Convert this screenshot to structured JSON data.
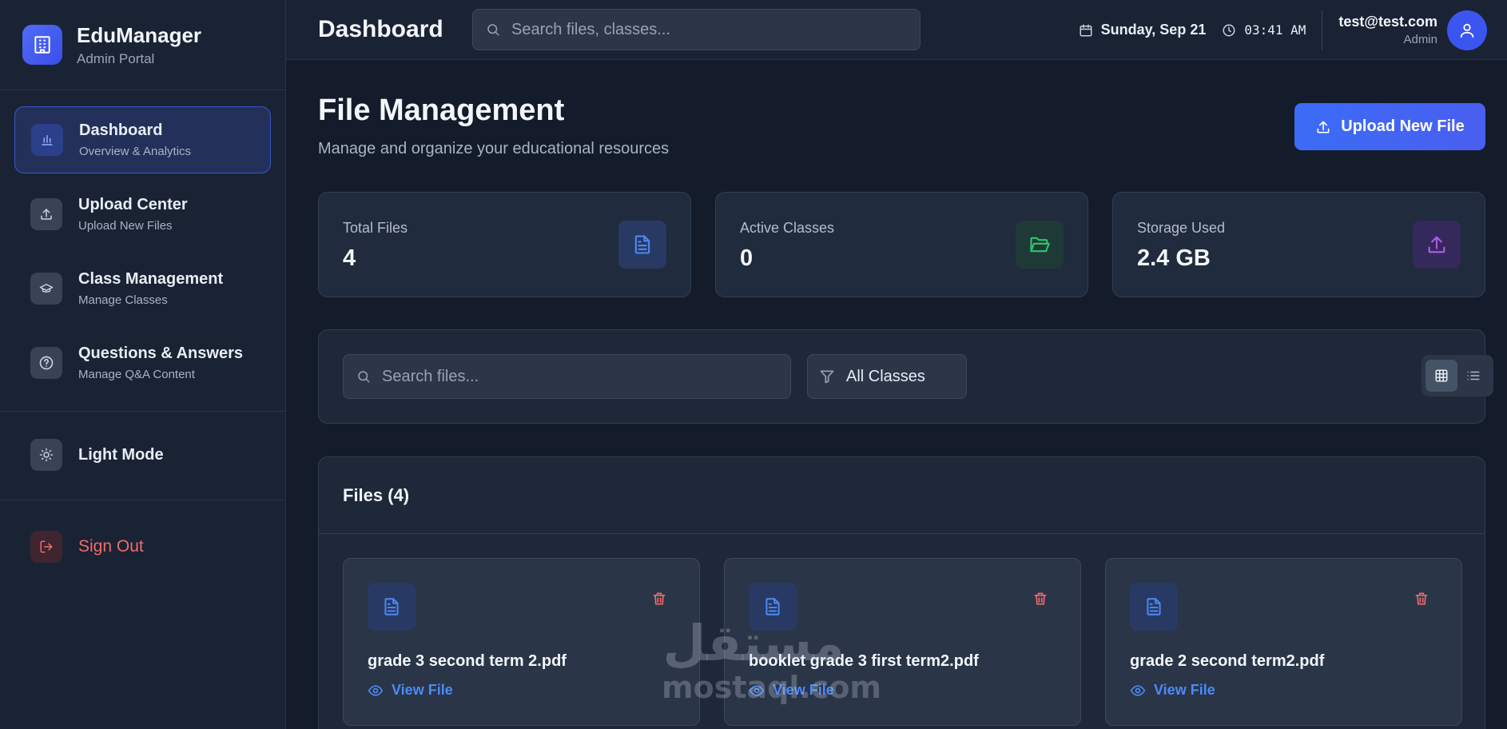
{
  "brand": {
    "name": "EduManager",
    "subtitle": "Admin Portal"
  },
  "sidebar": {
    "items": [
      {
        "label": "Dashboard",
        "sub": "Overview & Analytics",
        "icon": "bar-chart-icon",
        "active": true
      },
      {
        "label": "Upload Center",
        "sub": "Upload New Files",
        "icon": "upload-icon"
      },
      {
        "label": "Class Management",
        "sub": "Manage Classes",
        "icon": "graduation-cap-icon"
      },
      {
        "label": "Questions & Answers",
        "sub": "Manage Q&A Content",
        "icon": "question-circle-icon"
      }
    ],
    "mode_label": "Light Mode",
    "signout_label": "Sign Out"
  },
  "header": {
    "title": "Dashboard",
    "search_placeholder": "Search files, classes...",
    "date": "Sunday, Sep 21",
    "time": "03:41 AM",
    "user_email": "test@test.com",
    "user_role": "Admin"
  },
  "main": {
    "title": "File Management",
    "subtitle": "Manage and organize your educational resources",
    "upload_button": "Upload New File",
    "stats": [
      {
        "label": "Total Files",
        "value": "4",
        "icon": "document-icon",
        "color": "#4d8af5"
      },
      {
        "label": "Active Classes",
        "value": "0",
        "icon": "folder-open-icon",
        "color": "#2fc76b"
      },
      {
        "label": "Storage Used",
        "value": "2.4 GB",
        "icon": "upload-icon",
        "color": "#b25cf0"
      }
    ],
    "filter": {
      "search_placeholder": "Search files...",
      "class_select": "All Classes",
      "view_mode": "grid"
    },
    "files_heading": "Files (4)",
    "files": [
      {
        "name": "grade 3 second term 2.pdf",
        "action": "View File"
      },
      {
        "name": "booklet grade 3 first term2.pdf",
        "action": "View File"
      },
      {
        "name": "grade 2 second term2.pdf",
        "action": "View File"
      }
    ]
  },
  "watermark": {
    "arabic": "مستقل",
    "latin": "mostaql.com"
  },
  "colors": {
    "accent": "#3b6cf5",
    "danger": "#f26a6a",
    "background": "#141c2c",
    "panel": "#1e2839"
  }
}
